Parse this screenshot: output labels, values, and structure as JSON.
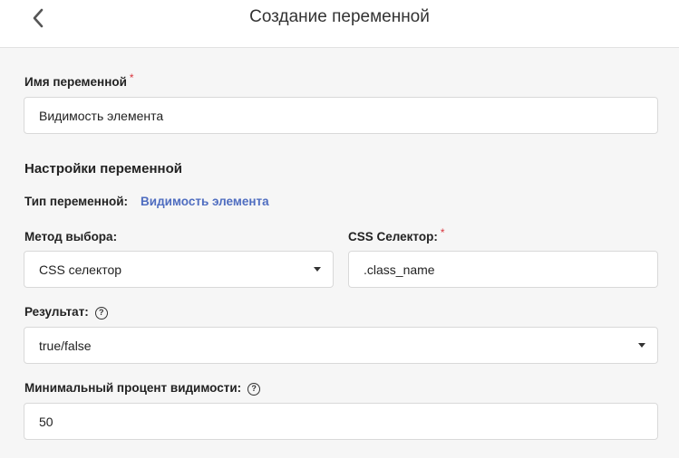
{
  "header": {
    "title": "Создание переменной",
    "back_icon": "chevron-left-icon"
  },
  "form": {
    "name_label": "Имя переменной",
    "name_value": "Видимость элемента",
    "required_mark": "*",
    "settings_title": "Настройки переменной",
    "type_label": "Тип переменной:",
    "type_value": "Видимость элемента",
    "method_label": "Метод выбора:",
    "method_value": "CSS селектор",
    "css_selector_label": "CSS Селектор:",
    "css_selector_value": ".class_name",
    "result_label": "Результат:",
    "result_value": "true/false",
    "min_visibility_label": "Минимальный процент видимости:",
    "min_visibility_value": "50",
    "help_icon_glyph": "?"
  },
  "colors": {
    "accent": "#4f6dc0",
    "required": "#d9363e",
    "background": "#f6f6f6"
  }
}
